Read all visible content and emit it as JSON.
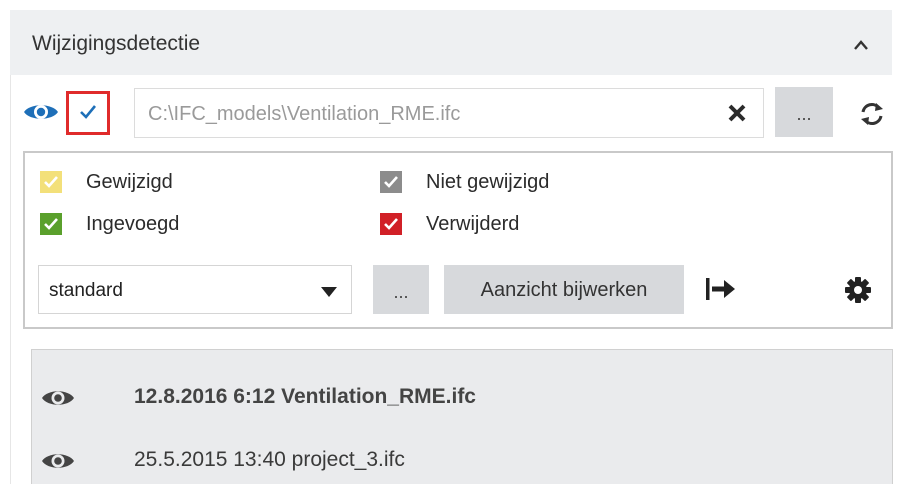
{
  "panel": {
    "title": "Wijzigingsdetectie"
  },
  "file": {
    "path": "C:\\IFC_models\\Ventilation_RME.ifc",
    "browse_label": "...",
    "checked": true
  },
  "legend": [
    {
      "label": "Gewijzigd",
      "color": "#f3e07a"
    },
    {
      "label": "Niet gewijzigd",
      "color": "#8c8c8c"
    },
    {
      "label": "Ingevoegd",
      "color": "#5aa02c"
    },
    {
      "label": "Verwijderd",
      "color": "#d12027"
    }
  ],
  "view": {
    "selected": "standard",
    "dots_label": "...",
    "update_label": "Aanzicht bijwerken"
  },
  "history": [
    {
      "label": "12.8.2016 6:12 Ventilation_RME.ifc",
      "bold": true
    },
    {
      "label": "25.5.2015 13:40 project_3.ifc",
      "bold": false
    }
  ],
  "colors": {
    "accent_blue": "#1e6fb8",
    "highlight_red": "#e02b2b",
    "button_gray": "#d7d9dc"
  }
}
